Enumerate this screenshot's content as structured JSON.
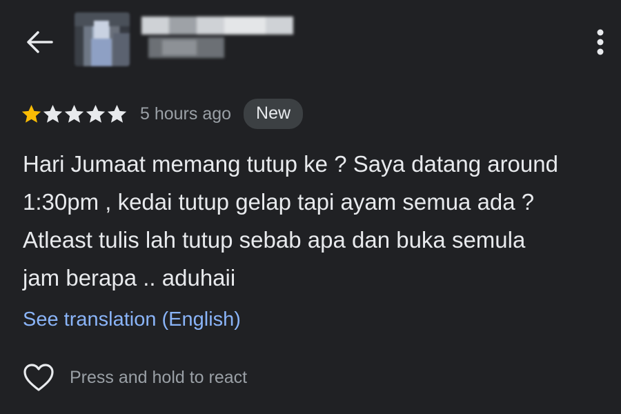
{
  "header": {
    "back_icon": "arrow-back-icon",
    "more_icon": "more-vertical-icon"
  },
  "review": {
    "rating": 1,
    "rating_max": 5,
    "colors": {
      "star_filled": "#fbbc04",
      "star_empty": "#e8eaed"
    },
    "time": "5 hours ago",
    "badge": "New",
    "text": "Hari Jumaat memang tutup ke ? Saya datang around\n1:30pm , kedai tutup gelap tapi ayam semua ada ?\nAtleast tulis lah tutup sebab apa dan buka semula\njam berapa .. aduhaii",
    "translate_link": "See translation (English)",
    "react_icon": "heart-outline-icon",
    "react_label": "Press and hold to react"
  },
  "colors": {
    "background": "#202124",
    "link": "#8ab4f8",
    "secondary_text": "#9aa0a6",
    "badge_bg": "#3c4043"
  }
}
